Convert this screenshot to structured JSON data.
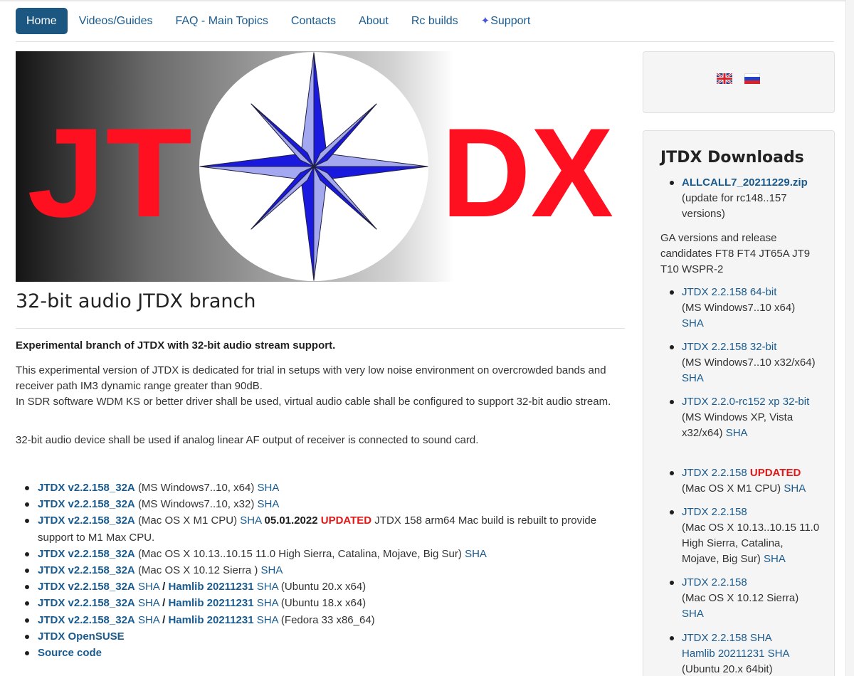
{
  "nav": {
    "items": [
      "Home",
      "Videos/Guides",
      "FAQ - Main Topics",
      "Contacts",
      "About",
      "Rc builds"
    ],
    "support_label": "Support",
    "active": "Home"
  },
  "banner": {
    "left_text": "JT",
    "right_text": "DX"
  },
  "main": {
    "title": "32-bit audio JTDX branch",
    "bold_intro": "Experimental branch of JTDX with 32-bit audio stream support.",
    "para1_line1": "This experimental version of JTDX is dedicated for trial in setups with very low noise environment on overcrowded bands and receiver path IM3 dynamic range greater than 90dB.",
    "para1_line2": "In SDR software WDM KS or better driver shall be used, virtual audio cable shall be configured to support 32-bit audio stream.",
    "para2": "32-bit audio device shall be used if analog linear AF output of receiver is connected to sound card.",
    "downloads": [
      {
        "link": "JTDX v2.2.158_32A",
        "desc": "(MS Windows7..10, x64)",
        "sha": "SHA"
      },
      {
        "link": "JTDX v2.2.158_32A",
        "desc": "(MS Windows7..10, x32)",
        "sha": "SHA"
      },
      {
        "link": "JTDX v2.2.158_32A",
        "desc": "(Mac OS X M1 CPU)",
        "sha": "SHA",
        "date": "05.01.2022",
        "updated": "UPDATED",
        "note": "JTDX 158 arm64 Mac build is rebuilt to provide support to M1 Max CPU."
      },
      {
        "link": "JTDX v2.2.158_32A",
        "desc": "(Mac OS X 10.13..10.15 11.0 High Sierra, Catalina, Mojave, Big Sur)",
        "sha": "SHA"
      },
      {
        "link": "JTDX v2.2.158_32A",
        "desc": "(Mac OS X 10.12 Sierra )",
        "sha": "SHA"
      },
      {
        "link": "JTDX v2.2.158_32A",
        "sha": "SHA",
        "sep": "/",
        "hamlib": "Hamlib 20211231",
        "sha2": "SHA",
        "desc": "(Ubuntu 20.x x64)"
      },
      {
        "link": "JTDX v2.2.158_32A",
        "sha": "SHA",
        "sep": "/",
        "hamlib": "Hamlib 20211231",
        "sha2": "SHA",
        "desc": "(Ubuntu 18.x x64)"
      },
      {
        "link": "JTDX v2.2.158_32A",
        "sha": "SHA",
        "sep": "/",
        "hamlib": "Hamlib 20211231",
        "sha2": "SHA",
        "desc": "(Fedora 33 x86_64)"
      },
      {
        "link": "JTDX OpenSUSE"
      },
      {
        "link": "Source code"
      }
    ]
  },
  "sidebar": {
    "title": "JTDX Downloads",
    "allcall": {
      "link": "ALLCALL7_20211229.zip",
      "desc": "(update for rc148..157 versions)"
    },
    "ga_text": "GA versions and release candidates FT8 FT4 JT65A JT9 T10 WSPR-2",
    "items": [
      {
        "link": "JTDX 2.2.158 64-bit",
        "desc": "(MS Windows7..10 x64)",
        "sha": "SHA"
      },
      {
        "link": "JTDX 2.2.158 32-bit",
        "desc": "(MS Windows7..10 x32/x64)",
        "sha": "SHA"
      },
      {
        "link": "JTDX 2.2.0-rc152 xp 32-bit",
        "desc": "(MS Windows XP, Vista x32/x64)",
        "sha": "SHA"
      },
      {
        "link": "JTDX 2.2.158",
        "updated": "UPDATED",
        "desc": "(Mac OS X M1 CPU)",
        "sha": "SHA"
      },
      {
        "link": "JTDX 2.2.158",
        "desc": "(Mac OS X 10.13..10.15 11.0 High Sierra, Catalina, Mojave, Big Sur)",
        "sha": "SHA"
      },
      {
        "link": "JTDX 2.2.158",
        "desc": "(Mac OS X 10.12 Sierra)",
        "sha": "SHA"
      },
      {
        "link": "JTDX 2.2.158",
        "sha": "SHA",
        "hamlib": "Hamlib 20211231",
        "sha2": "SHA",
        "desc": "(Ubuntu 20.x 64bit)"
      }
    ]
  },
  "colors": {
    "nav_active_bg": "#1b5780",
    "link": "#1a5b8f",
    "updated_red": "#e01818",
    "logo_red": "#ff1020",
    "star_dark": "#1a1adf",
    "star_light": "#a4a8f0"
  }
}
